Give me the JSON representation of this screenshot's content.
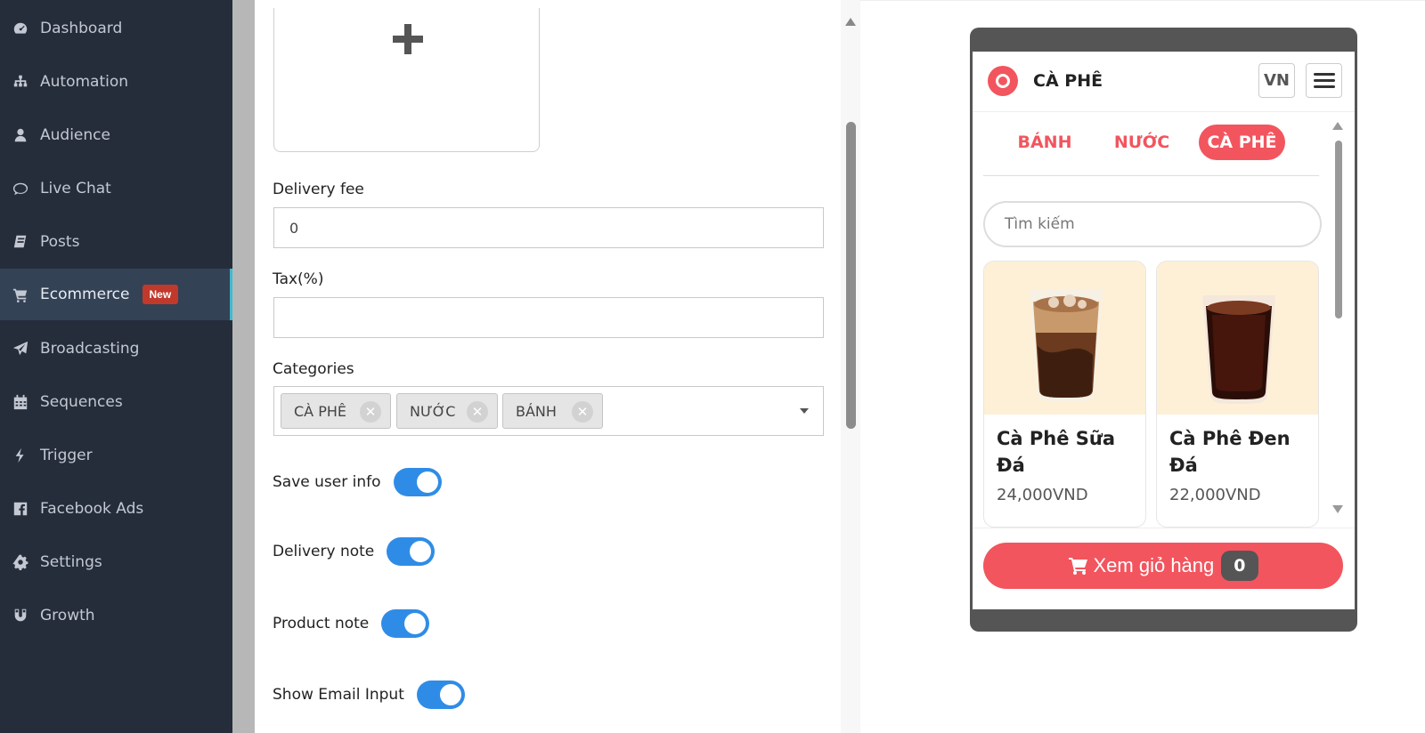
{
  "sidebar": {
    "items": [
      {
        "label": "Dashboard",
        "icon": "dashboard-icon"
      },
      {
        "label": "Automation",
        "icon": "sitemap-icon"
      },
      {
        "label": "Audience",
        "icon": "user-icon"
      },
      {
        "label": "Live Chat",
        "icon": "chat-icon"
      },
      {
        "label": "Posts",
        "icon": "book-icon"
      },
      {
        "label": "Ecommerce",
        "icon": "cart-icon",
        "badge": "New",
        "active": true
      },
      {
        "label": "Broadcasting",
        "icon": "paper-plane-icon"
      },
      {
        "label": "Sequences",
        "icon": "calendar-icon"
      },
      {
        "label": "Trigger",
        "icon": "bolt-icon"
      },
      {
        "label": "Facebook Ads",
        "icon": "facebook-icon"
      },
      {
        "label": "Settings",
        "icon": "gear-icon"
      },
      {
        "label": "Growth",
        "icon": "magnet-icon"
      }
    ]
  },
  "form": {
    "delivery_fee": {
      "label": "Delivery fee",
      "value": "0"
    },
    "tax": {
      "label": "Tax(%)",
      "value": ""
    },
    "categories": {
      "label": "Categories",
      "tags": [
        "CÀ PHÊ",
        "NƯỚC",
        "BÁNH"
      ]
    },
    "toggles": [
      {
        "label": "Save user info",
        "on": true
      },
      {
        "label": "Delivery note",
        "on": true
      },
      {
        "label": "Product note",
        "on": true
      },
      {
        "label": "Show Email Input",
        "on": true
      }
    ]
  },
  "preview": {
    "title": "CÀ PHÊ",
    "lang": "VN",
    "tabs": [
      {
        "label": "BÁNH",
        "active": false
      },
      {
        "label": "NƯỚC",
        "active": false
      },
      {
        "label": "CÀ PHÊ",
        "active": true
      }
    ],
    "search_placeholder": "Tìm kiếm",
    "products": [
      {
        "name": "Cà Phê Sữa Đá",
        "price": "24,000VND"
      },
      {
        "name": "Cà Phê Đen Đá",
        "price": "22,000VND"
      }
    ],
    "cart": {
      "label": "Xem giỏ hàng",
      "count": "0"
    }
  },
  "colors": {
    "sidebar_bg": "#252d3b",
    "accent": "#f2555e",
    "toggle_on": "#2f8ce6",
    "badge_new": "#c0392b"
  }
}
